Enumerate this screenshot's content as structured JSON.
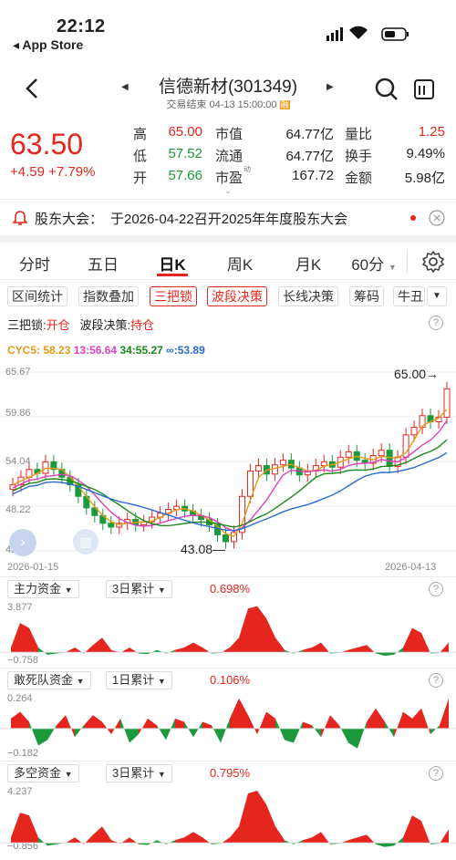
{
  "status_bar": {
    "time": "22:12",
    "back_label": "◂ App Store"
  },
  "header": {
    "title": "信德新材(301349)",
    "subtitle": "交易结束 04-13 15:00:00",
    "badge": "融"
  },
  "quote": {
    "price": "63.50",
    "change": "+4.59  +7.79%",
    "rows": [
      {
        "l1": "高",
        "v1": "65.00",
        "c1": "red",
        "l2": "市值",
        "v2": "64.77亿",
        "l3": "量比",
        "v3": "1.25",
        "c3": "red"
      },
      {
        "l1": "低",
        "v1": "57.52",
        "c1": "green",
        "l2": "流通",
        "v2": "64.77亿",
        "l3": "换手",
        "v3": "9.49%",
        "c3": "dark"
      },
      {
        "l1": "开",
        "v1": "57.66",
        "c1": "green",
        "l2": "市盈",
        "v2": "167.72",
        "l3": "金额",
        "v3": "5.98亿",
        "c3": "dark"
      }
    ],
    "pe_sup": "动"
  },
  "notice": {
    "label": "股东大会：",
    "text": "于2026-04-22召开2025年年度股东大会"
  },
  "period_tabs": [
    "分时",
    "五日",
    "日K",
    "周K",
    "月K",
    "60分"
  ],
  "active_tab": "日K",
  "chips": [
    {
      "label": "区间统计",
      "on": false
    },
    {
      "label": "指数叠加",
      "on": false
    },
    {
      "label": "三把锁",
      "on": true
    },
    {
      "label": "波段决策",
      "on": true
    },
    {
      "label": "长线决策",
      "on": false
    },
    {
      "label": "筹码",
      "on": false
    },
    {
      "label": "牛丑",
      "on": false
    }
  ],
  "signals": {
    "lock_label": "三把锁:",
    "lock_value": "开仓",
    "band_label": "波段决策:",
    "band_value": "持仓"
  },
  "cyc": {
    "name": "CYC5:",
    "v5": "58.23",
    "l13": "13:",
    "v13": "56.64",
    "l34": "34:",
    "v34": "55.27",
    "linf": "∞:",
    "vinf": "53.89"
  },
  "main_chart": {
    "y_labels": [
      "65.67",
      "59.86",
      "54.04",
      "48.22",
      "42.41"
    ],
    "high_label": "65.00→",
    "low_label": "43.08—",
    "start_date": "2026-01-15",
    "end_date": "2026-04-13"
  },
  "sub_charts": [
    {
      "name": "主力资金",
      "period": "3日累计",
      "value": "0.698%",
      "top": "3.877",
      "bottom": "−0.758"
    },
    {
      "name": "敢死队资金",
      "period": "1日累计",
      "value": "0.106%",
      "top": "0.264",
      "bottom": "−0.182"
    },
    {
      "name": "多空资金",
      "period": "3日累计",
      "value": "0.795%",
      "top": "4.237",
      "bottom": "−0.856"
    }
  ],
  "colors": {
    "up": "#e5261f",
    "down": "#1a9a3a",
    "accent": "#e5261f"
  },
  "chart_data": {
    "type": "candlestick",
    "y_range": [
      42.41,
      65.67
    ],
    "close_last": 63.5,
    "high": 65.0,
    "low": 43.08
  }
}
